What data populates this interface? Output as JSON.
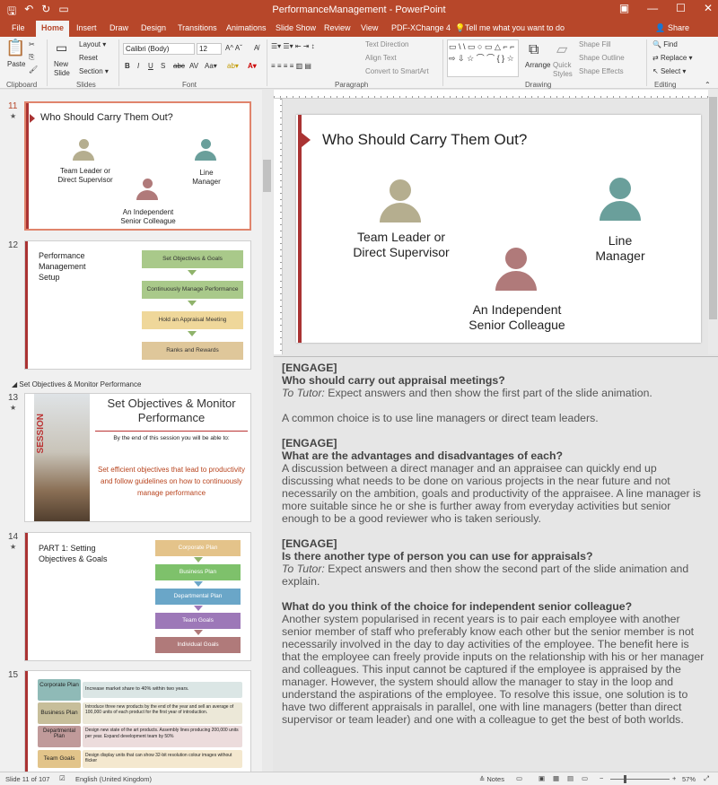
{
  "window": {
    "title": "PerformanceManagement - PowerPoint"
  },
  "qat": [
    "save-icon",
    "undo-icon",
    "redo-icon",
    "start-from-beginning-icon"
  ],
  "tabs": [
    "File",
    "Home",
    "Insert",
    "Draw",
    "Design",
    "Transitions",
    "Animations",
    "Slide Show",
    "Review",
    "View",
    "PDF-XChange 4"
  ],
  "tell_me": "Tell me what you want to do",
  "share": "Share",
  "ribbon": {
    "clipboard": {
      "paste": "Paste",
      "label": "Clipboard"
    },
    "slides": {
      "new_slide": "New Slide",
      "layout": "Layout",
      "reset": "Reset",
      "section": "Section",
      "label": "Slides"
    },
    "font": {
      "name": "Calibri (Body)",
      "size": "12",
      "label": "Font"
    },
    "paragraph": {
      "text_direction": "Text Direction",
      "align_text": "Align Text",
      "smartart": "Convert to SmartArt",
      "label": "Paragraph"
    },
    "drawing": {
      "arrange": "Arrange",
      "quick_styles": "Quick Styles",
      "shape_fill": "Shape Fill",
      "shape_outline": "Shape Outline",
      "shape_effects": "Shape Effects",
      "label": "Drawing"
    },
    "editing": {
      "find": "Find",
      "replace": "Replace",
      "select": "Select",
      "label": "Editing"
    }
  },
  "thumbnails": [
    {
      "num": "11",
      "title": "Who Should Carry Them Out?",
      "p1": "Team Leader or Direct Supervisor",
      "p2": "Line Manager",
      "p3": "An Independent Senior Colleague"
    },
    {
      "num": "12",
      "title": "Performance Management Setup",
      "steps": [
        "Set Objectives & Goals",
        "Continuously Manage Performance",
        "Hold an Appraisal Meeting",
        "Ranks and Rewards"
      ]
    },
    {
      "section": "Set Objectives & Monitor Performance"
    },
    {
      "num": "13",
      "title": "Set Objectives & Monitor Performance",
      "sub": "By the end of this session you will be able to:",
      "body": "Set efficient objectives that lead to productivity and follow guidelines on how to continuously manage performance",
      "vert": "SESSION"
    },
    {
      "num": "14",
      "title": "PART 1: Setting Objectives & Goals",
      "steps": [
        "Corporate Plan",
        "Business Plan",
        "Departmental Plan",
        "Team Goals",
        "Individual Goals"
      ]
    },
    {
      "num": "15",
      "rows": [
        {
          "label": "Corporate Plan",
          "text": "Increase market share to 40% within two years."
        },
        {
          "label": "Business Plan",
          "text": "Introduce three new products by the end of the year and sell an average of 100,000 units of each product for the first year of introduction."
        },
        {
          "label": "Departmental Plan",
          "text": "Design new state of the art products. Assembly lines producing 200,000 units per year. Expand development team by 50%"
        },
        {
          "label": "Team Goals",
          "text": "Design display units that can show 32-bit resolution colour images without flicker"
        }
      ]
    }
  ],
  "slide": {
    "title": "Who Should Carry Them Out?",
    "p1": "Team Leader or Direct Supervisor",
    "p2": "Line Manager",
    "p3": "An Independent Senior Colleague"
  },
  "notes": {
    "engage1": "[ENGAGE]",
    "q1": "Who should carry out appraisal meetings?",
    "tutor_label": "To Tutor:",
    "t1": "Expect answers and then show the first part of the slide animation.",
    "c1": "A common choice is to use line managers or direct team leaders.",
    "engage2": "[ENGAGE]",
    "q2": "What are the advantages and disadvantages of each?",
    "c2": "A discussion between a direct manager and an appraisee can quickly end up discussing what needs to be done on various projects in the near future and not necessarily on the ambition, goals and productivity of the appraisee. A line manager is more suitable since he or she is further away from everyday activities but senior enough to be a good reviewer who is taken seriously.",
    "engage3": "[ENGAGE]",
    "q3": "Is there another type of person you can use for appraisals?",
    "t3": "Expect answers and then show the second part of the slide animation and explain.",
    "q4": "What do you think of the choice for independent senior colleague?",
    "c4": "Another system popularised in recent years is to pair each employee with another senior member of staff who preferably know each other but the senior member is not necessarily involved in the day to day activities of the employee. The benefit here is that the employee can freely provide inputs on the relationship with his or her manager and colleagues. This input cannot be captured if the employee is appraised by the manager. However, the system should allow the manager to stay in the loop and understand the aspirations of the employee. To resolve this issue, one solution is to have two different appraisals in parallel, one with line managers (better than direct supervisor or team leader) and one with a colleague to get the best of both worlds."
  },
  "status": {
    "slide": "Slide 11 of 107",
    "language": "English (United Kingdom)",
    "notes": "Notes",
    "zoom": "57%"
  },
  "colors": {
    "accent": "#b7472a",
    "person1": "#b5ae8f",
    "person2": "#6a9f9b",
    "person3": "#b07a7a"
  }
}
